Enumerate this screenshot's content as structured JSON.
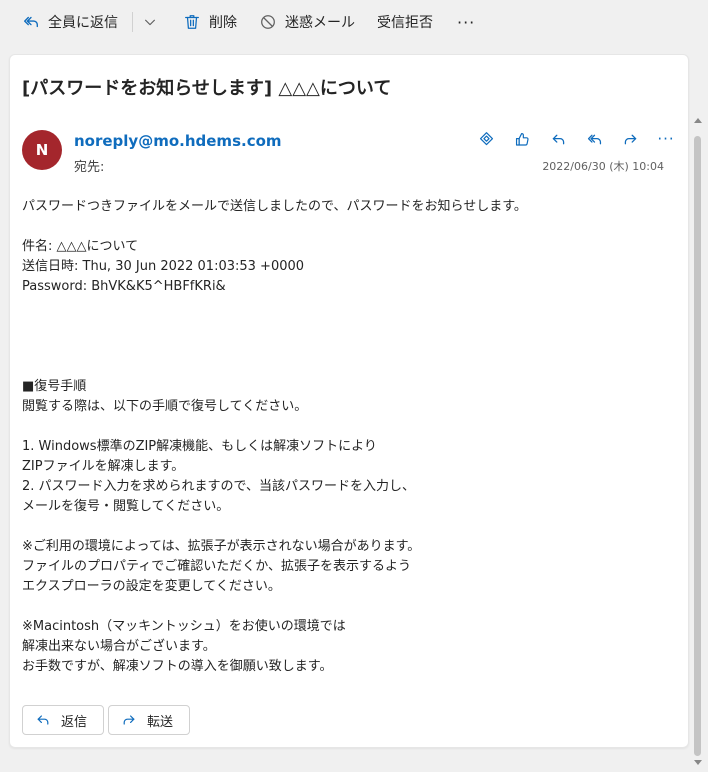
{
  "toolbar": {
    "reply_all_label": "全員に返信",
    "delete_label": "削除",
    "junk_label": "迷惑メール",
    "block_label": "受信拒否",
    "more_label": "···"
  },
  "message": {
    "subject": "[パスワードをお知らせします] △△△について",
    "avatar_initial": "N",
    "avatar_color": "#a4262c",
    "sender": "noreply@mo.hdems.com",
    "to_label": "宛先:",
    "date": "2022/06/30 (木) 10:04",
    "more_label": "···",
    "body": {
      "intro": "パスワードつきファイルをメールで送信しましたので、パスワードをお知らせします。",
      "subject_line": "件名: △△△について",
      "sent_line": "送信日時: Thu, 30 Jun 2022 01:03:53 +0000",
      "password_line": "Password: BhVK&K5^HBFfKRi&",
      "heading": "■復号手順",
      "l1": "閲覧する際は、以下の手順で復号してください。",
      "l2": "1. Windows標準のZIP解凍機能、もしくは解凍ソフトにより",
      "l3": "ZIPファイルを解凍します。",
      "l4": "2. パスワード入力を求められますので、当該パスワードを入力し、",
      "l5": "メールを復号・閲覧してください。",
      "l6": "※ご利用の環境によっては、拡張子が表示されない場合があります。",
      "l7": "ファイルのプロパティでご確認いただくか、拡張子を表示するよう",
      "l8": "エクスプローラの設定を変更してください。",
      "l9": "※Macintosh（マッキントッシュ）をお使いの環境では",
      "l10": "解凍出来ない場合がございます。",
      "l11": "お手数ですが、解凍ソフトの導入を御願い致します。"
    },
    "reply_label": "返信",
    "forward_label": "転送"
  },
  "colors": {
    "accent": "#0f6cbd",
    "background": "#f0f0f0"
  }
}
